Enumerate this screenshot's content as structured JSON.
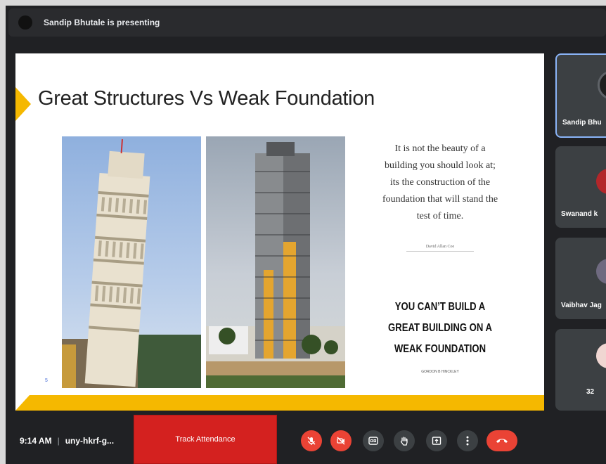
{
  "presenter_banner": {
    "text": "Sandip Bhutale is presenting"
  },
  "slide": {
    "title": "Great Structures Vs Weak Foundation",
    "quote_lines": [
      "It is not the beauty of a",
      "building you should look at;",
      "its the construction of the",
      "foundation that will stand the",
      "test of time."
    ],
    "quote_author": "David Allan Coe",
    "headline_lines": [
      "YOU CAN’T BUILD A",
      "GREAT BUILDING ON A",
      "WEAK FOUNDATION"
    ],
    "headline_author": "GORDON B HINCKLEY",
    "slide_number": "5"
  },
  "participants": [
    {
      "name": "Sandip Bhu",
      "active": true,
      "avatar": "presenter-avatar"
    },
    {
      "name": "Swanand k",
      "active": false,
      "avatar": "person-avatar"
    },
    {
      "name": "Vaibhav Jag",
      "active": false,
      "avatar": "person-avatar"
    },
    {
      "name": "32",
      "active": false,
      "avatar": "person-avatar"
    }
  ],
  "bottom_bar": {
    "time": "9:14 AM",
    "separator": "|",
    "meeting_code": "uny-hkrf-g...",
    "track_attendance_label": "Track Attendance",
    "controls": [
      "mic-off-icon",
      "camera-off-icon",
      "captions-icon",
      "raise-hand-icon",
      "present-screen-icon",
      "more-options-icon",
      "end-call-icon"
    ]
  },
  "colors": {
    "accent_yellow": "#f5b800",
    "control_red": "#ea4335",
    "attendance_red": "#d4211f",
    "background": "#202124"
  }
}
